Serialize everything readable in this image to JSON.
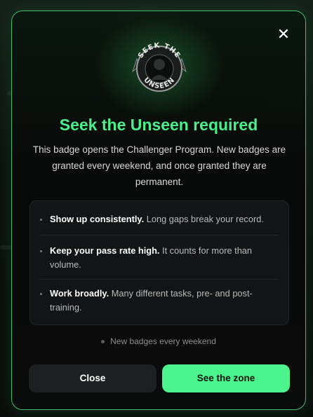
{
  "dialog": {
    "title": "Seek the Unseen required",
    "description": "This badge opens the Challenger Program. New badges are granted every weekend, and once granted they are permanent.",
    "close_icon": "close-icon",
    "badge": {
      "icon": "seek-the-unseen-badge",
      "text": "SEEK THE UNSEEN"
    },
    "requirements": [
      {
        "bold": "Show up consistently.",
        "text": " Long gaps break your record."
      },
      {
        "bold": "Keep your pass rate high.",
        "text": " It counts for more than volume."
      },
      {
        "bold": "Work broadly.",
        "text": " Many different tasks, pre- and post-training."
      }
    ],
    "note": "New badges every weekend",
    "buttons": {
      "close_label": "Close",
      "primary_label": "See the zone"
    }
  },
  "colors": {
    "accent": "#4bf08a",
    "border": "#3fbf6a",
    "primary_button": "#4cf48e",
    "secondary_button": "#1d1f20"
  }
}
